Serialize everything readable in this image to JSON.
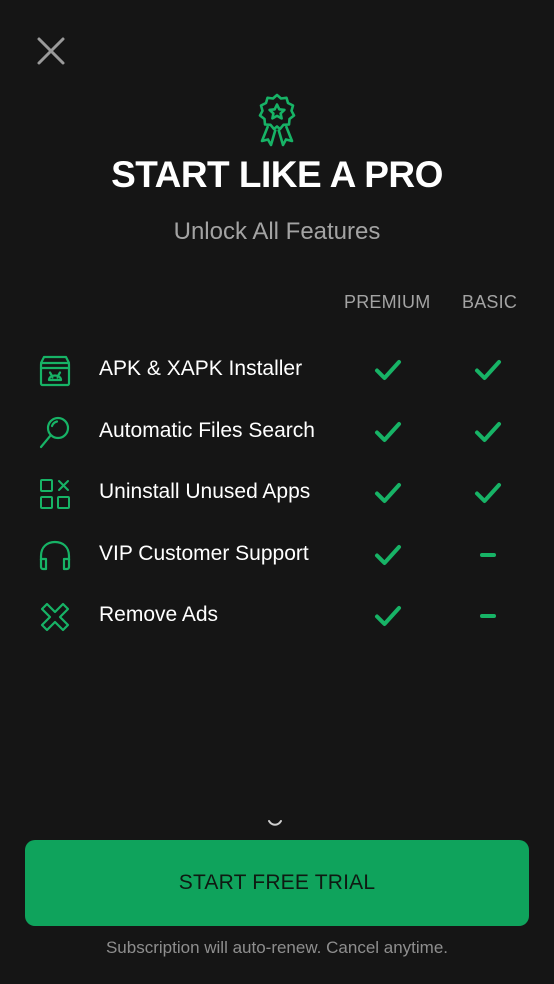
{
  "colors": {
    "background": "#151515",
    "accent": "#0fa35c",
    "check": "#17b366",
    "muted_text": "#a3a3a3"
  },
  "close": {
    "icon": "close-icon"
  },
  "header": {
    "badge_icon": "award-ribbon-icon",
    "title": "START LIKE A PRO",
    "subtitle": "Unlock All Features"
  },
  "columns": {
    "premium": "PREMIUM",
    "basic": "BASIC"
  },
  "features": [
    {
      "label": "APK & XAPK Installer",
      "icon": "android-box-icon",
      "premium": "check",
      "basic": "check"
    },
    {
      "label": "Automatic Files Search",
      "icon": "magnifier-icon",
      "premium": "check",
      "basic": "check"
    },
    {
      "label": "Uninstall Unused Apps",
      "icon": "apps-grid-remove-icon",
      "premium": "check",
      "basic": "check"
    },
    {
      "label": "VIP Customer Support",
      "icon": "headset-icon",
      "premium": "check",
      "basic": "dash"
    },
    {
      "label": "Remove Ads",
      "icon": "remove-ads-icon",
      "premium": "check",
      "basic": "dash"
    }
  ],
  "cta": {
    "label": "START FREE TRIAL"
  },
  "footer": {
    "note": "Subscription will auto-renew. Cancel anytime."
  }
}
